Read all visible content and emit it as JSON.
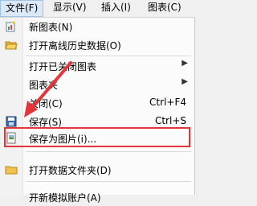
{
  "menubar": {
    "items": [
      {
        "label": "文件(F)",
        "active": true
      },
      {
        "label": "显示(V)"
      },
      {
        "label": "插入(I)"
      },
      {
        "label": "图表(C)"
      }
    ]
  },
  "menu": {
    "items": [
      {
        "label": "新图表(N)",
        "icon": "new-chart-icon"
      },
      {
        "label": "打开离线历史数据(O)",
        "icon": "folder-open-icon"
      },
      {
        "label": "打开已关闭图表",
        "submenu": true
      },
      {
        "label": "图表夹",
        "submenu": true
      },
      {
        "label": "关闭(C)",
        "shortcut": "Ctrl+F4"
      },
      {
        "label": "保存(S)",
        "shortcut": "Ctrl+S",
        "icon": "save-icon"
      },
      {
        "label": "保存为图片(i)...",
        "icon": "save-picture-icon",
        "highlighted": true
      },
      {
        "label": "打开数据文件夹(D)",
        "icon": "folder-icon"
      },
      {
        "label": "开新模拟账户(A)"
      }
    ],
    "submenu_arrow": "▶"
  },
  "colors": {
    "highlight": "#e5353b",
    "menubar_active": "#dbe8f6"
  }
}
